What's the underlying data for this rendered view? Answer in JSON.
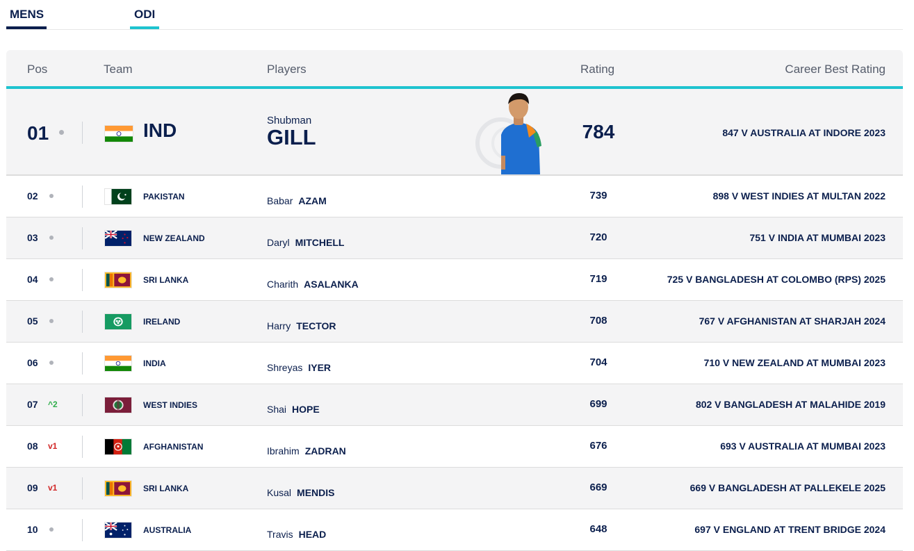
{
  "tabs": [
    {
      "label": "MENS"
    },
    {
      "label": "ODI"
    }
  ],
  "headers": {
    "pos": "Pos",
    "team": "Team",
    "players": "Players",
    "rating": "Rating",
    "career_best": "Career Best Rating"
  },
  "colors": {
    "navy": "#0b1f4d",
    "accent": "#1ec3cf",
    "up": "#2fae4b",
    "down": "#d12727"
  },
  "top": {
    "pos": "01",
    "movement": "same",
    "flag": "india-flag",
    "team": "IND",
    "first": "Shubman",
    "last": "GILL",
    "rating": "784",
    "best": "847 V AUSTRALIA AT INDORE 2023",
    "photo": "player-photo"
  },
  "rows": [
    {
      "pos": "02",
      "movement": "same",
      "change": "",
      "flag": "pakistan-flag",
      "team": "PAKISTAN",
      "first": "Babar",
      "last": "AZAM",
      "rating": "739",
      "best": "898 V WEST INDIES AT MULTAN 2022"
    },
    {
      "pos": "03",
      "movement": "same",
      "change": "",
      "flag": "new-zealand-flag",
      "team": "NEW ZEALAND",
      "first": "Daryl",
      "last": "MITCHELL",
      "rating": "720",
      "best": "751 V INDIA AT MUMBAI 2023"
    },
    {
      "pos": "04",
      "movement": "same",
      "change": "",
      "flag": "sri-lanka-flag",
      "team": "SRI LANKA",
      "first": "Charith",
      "last": "ASALANKA",
      "rating": "719",
      "best": "725 V BANGLADESH AT COLOMBO (RPS) 2025"
    },
    {
      "pos": "05",
      "movement": "same",
      "change": "",
      "flag": "ireland-flag",
      "team": "IRELAND",
      "first": "Harry",
      "last": "TECTOR",
      "rating": "708",
      "best": "767 V AFGHANISTAN AT SHARJAH 2024"
    },
    {
      "pos": "06",
      "movement": "same",
      "change": "",
      "flag": "india-flag",
      "team": "INDIA",
      "first": "Shreyas",
      "last": "IYER",
      "rating": "704",
      "best": "710 V NEW ZEALAND AT MUMBAI 2023"
    },
    {
      "pos": "07",
      "movement": "up",
      "change": "^2",
      "flag": "west-indies-flag",
      "team": "WEST INDIES",
      "first": "Shai",
      "last": "HOPE",
      "rating": "699",
      "best": "802 V BANGLADESH AT MALAHIDE 2019"
    },
    {
      "pos": "08",
      "movement": "down",
      "change": "v1",
      "flag": "afghanistan-flag",
      "team": "AFGHANISTAN",
      "first": "Ibrahim",
      "last": "ZADRAN",
      "rating": "676",
      "best": "693 V AUSTRALIA AT MUMBAI 2023"
    },
    {
      "pos": "09",
      "movement": "down",
      "change": "v1",
      "flag": "sri-lanka-flag",
      "team": "SRI LANKA",
      "first": "Kusal",
      "last": "MENDIS",
      "rating": "669",
      "best": "669 V BANGLADESH AT PALLEKELE 2025"
    },
    {
      "pos": "10",
      "movement": "same",
      "change": "",
      "flag": "australia-flag",
      "team": "AUSTRALIA",
      "first": "Travis",
      "last": "HEAD",
      "rating": "648",
      "best": "697 V ENGLAND AT TRENT BRIDGE 2024"
    }
  ]
}
